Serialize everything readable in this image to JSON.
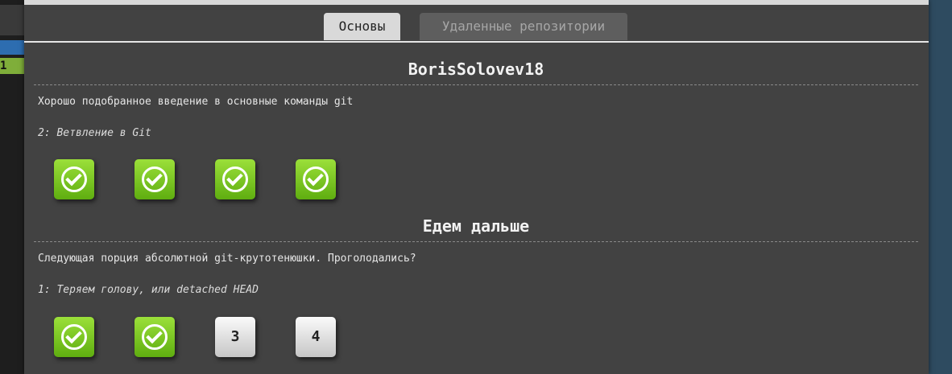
{
  "background": {
    "left_indicator": "1"
  },
  "tabs": [
    {
      "label": "Основы",
      "active": true
    },
    {
      "label": "Удаленные репозитории",
      "active": false
    }
  ],
  "sections": [
    {
      "title": "BorisSolovev18",
      "description": "Хорошо подобранное введение в основные команды git",
      "subtitle": "2: Ветвление в Git",
      "levels": [
        {
          "status": "completed",
          "icon": "check-circle-icon"
        },
        {
          "status": "completed",
          "icon": "check-circle-icon"
        },
        {
          "status": "completed",
          "icon": "check-circle-icon"
        },
        {
          "status": "completed",
          "icon": "check-circle-icon"
        }
      ]
    },
    {
      "title": "Едем дальше",
      "description": "Следующая порция абсолютной git-крутотенюшки. Проголодались?",
      "subtitle": "1: Теряем голову, или detached HEAD",
      "levels": [
        {
          "status": "completed",
          "icon": "check-circle-icon"
        },
        {
          "status": "completed",
          "icon": "check-circle-icon"
        },
        {
          "status": "pending",
          "label": "3"
        },
        {
          "status": "pending",
          "label": "4"
        }
      ]
    }
  ],
  "colors": {
    "dialog_bg": "#424242",
    "completed_green": "#7cc424",
    "pending_gray": "#e0e0e0",
    "active_tab": "#d9d9d9",
    "inactive_tab": "#5e5e5e"
  }
}
